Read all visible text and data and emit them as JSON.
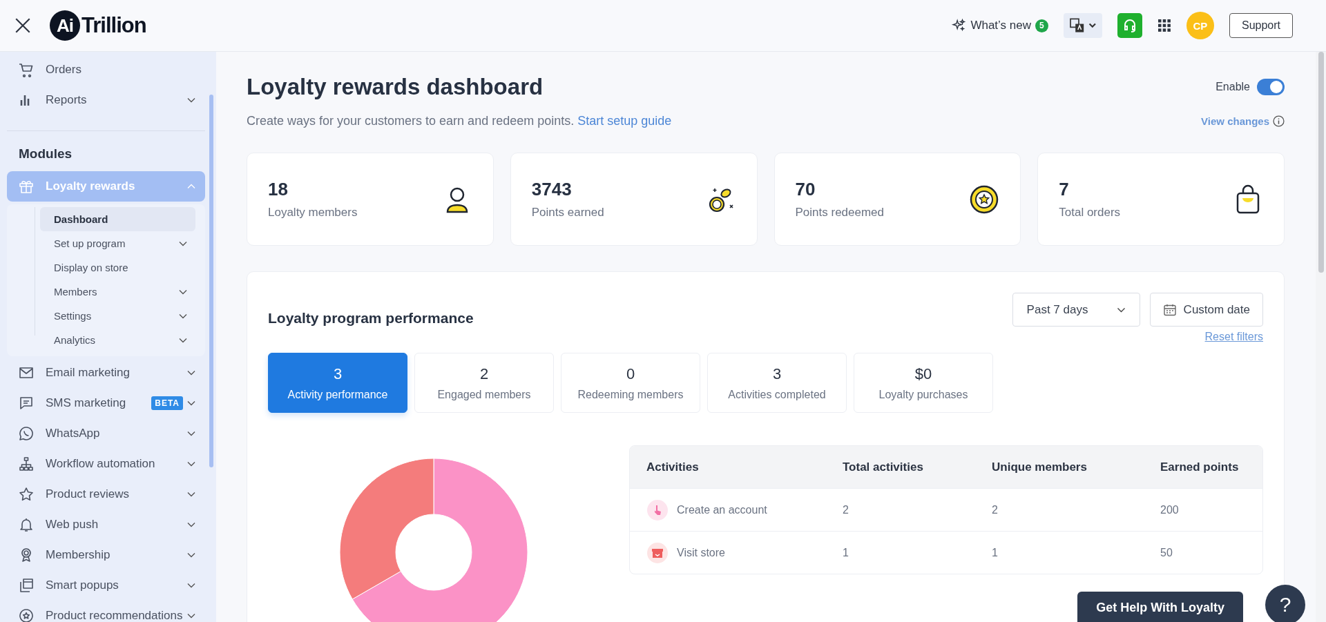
{
  "header": {
    "logo_mark": "Ai",
    "logo_text": "Trillion",
    "whats_new": {
      "label": "What’s new",
      "badge": "5"
    },
    "avatar": "CP",
    "support": "Support"
  },
  "sidebar": {
    "top_items": [
      {
        "label": "Orders",
        "has_submenu": false,
        "expanded": false
      },
      {
        "label": "Reports",
        "has_submenu": true,
        "expanded": false
      }
    ],
    "section_title": "Modules",
    "modules": [
      {
        "label": "Loyalty rewards",
        "selected": true,
        "expanded": true,
        "children": [
          {
            "label": "Dashboard",
            "selected": true,
            "has_submenu": false
          },
          {
            "label": "Set up program",
            "selected": false,
            "has_submenu": true
          },
          {
            "label": "Display on store",
            "selected": false,
            "has_submenu": false
          },
          {
            "label": "Members",
            "selected": false,
            "has_submenu": true
          },
          {
            "label": "Settings",
            "selected": false,
            "has_submenu": true
          },
          {
            "label": "Analytics",
            "selected": false,
            "has_submenu": true
          }
        ]
      },
      {
        "label": "Email marketing",
        "selected": false,
        "expanded": false
      },
      {
        "label": "SMS marketing",
        "selected": false,
        "expanded": false,
        "badge": "BETA"
      },
      {
        "label": "WhatsApp",
        "selected": false,
        "expanded": false
      },
      {
        "label": "Workflow automation",
        "selected": false,
        "expanded": false
      },
      {
        "label": "Product reviews",
        "selected": false,
        "expanded": false
      },
      {
        "label": "Web push",
        "selected": false,
        "expanded": false
      },
      {
        "label": "Membership",
        "selected": false,
        "expanded": false
      },
      {
        "label": "Smart popups",
        "selected": false,
        "expanded": false
      },
      {
        "label": "Product recommendations",
        "selected": false,
        "expanded": false
      }
    ]
  },
  "page": {
    "title": "Loyalty rewards dashboard",
    "subtitle": "Create ways for your customers to earn and redeem points.",
    "setup_link": "Start setup guide",
    "enable": {
      "label": "Enable",
      "on": true
    },
    "view_changes": "View changes"
  },
  "stats": [
    {
      "value": "18",
      "label": "Loyalty members"
    },
    {
      "value": "3743",
      "label": "Points earned"
    },
    {
      "value": "70",
      "label": "Points redeemed"
    },
    {
      "value": "7",
      "label": "Total orders"
    }
  ],
  "performance": {
    "title": "Loyalty program performance",
    "period": "Past 7 days",
    "custom_date": "Custom date",
    "reset": "Reset filters",
    "tabs": [
      {
        "value": "3",
        "label": "Activity performance",
        "selected": true
      },
      {
        "value": "2",
        "label": "Engaged members",
        "selected": false
      },
      {
        "value": "0",
        "label": "Redeeming members",
        "selected": false
      },
      {
        "value": "3",
        "label": "Activities completed",
        "selected": false
      },
      {
        "value": "$0",
        "label": "Loyalty purchases",
        "selected": false
      }
    ],
    "table": {
      "columns": [
        "Activities",
        "Total activities",
        "Unique members",
        "Earned points"
      ],
      "rows": [
        {
          "activity": "Create an account",
          "total": "2",
          "unique": "2",
          "earned": "200"
        },
        {
          "activity": "Visit store",
          "total": "1",
          "unique": "1",
          "earned": "50"
        }
      ]
    }
  },
  "help": {
    "label": "Get Help With Loyalty",
    "icon_text": "?"
  }
}
